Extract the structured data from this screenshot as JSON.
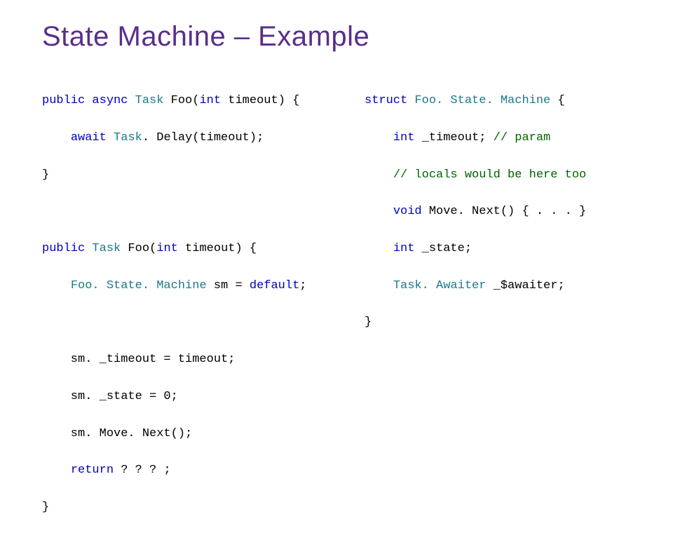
{
  "title": "State Machine – Example",
  "left": {
    "block1": {
      "l1a": "public",
      "l1b": " ",
      "l1c": "async",
      "l1d": " ",
      "l1e": "Task",
      "l1f": " Foo(",
      "l1g": "int",
      "l1h": " timeout) {",
      "l2a": "    ",
      "l2b": "await",
      "l2c": " ",
      "l2d": "Task",
      "l2e": ". Delay(timeout);",
      "l3": "}"
    },
    "block2": {
      "l1a": "public",
      "l1b": " ",
      "l1c": "Task",
      "l1d": " Foo(",
      "l1e": "int",
      "l1f": " timeout) {",
      "l2a": "    ",
      "l2b": "Foo. State. Machine",
      "l2c": " sm = ",
      "l2d": "default",
      "l2e": ";",
      "l3": "    sm. _timeout = timeout;",
      "l4": "    sm. _state = 0;",
      "l5": "    sm. Move. Next();",
      "l6a": "    ",
      "l6b": "return",
      "l6c": " ? ? ? ;",
      "l7": "}"
    }
  },
  "right": {
    "l1a": "struct",
    "l1b": " ",
    "l1c": "Foo. State. Machine",
    "l1d": " {",
    "l2a": "    ",
    "l2b": "int",
    "l2c": " _timeout; ",
    "l2d": "// param",
    "l3a": "    ",
    "l3b": "// locals would be here too",
    "l4a": "    ",
    "l4b": "void",
    "l4c": " Move. Next() { . . . }",
    "l5a": "    ",
    "l5b": "int",
    "l5c": " _state;",
    "l6a": "    ",
    "l6b": "Task. Awaiter",
    "l6c": " _$awaiter;",
    "l7": "}"
  }
}
